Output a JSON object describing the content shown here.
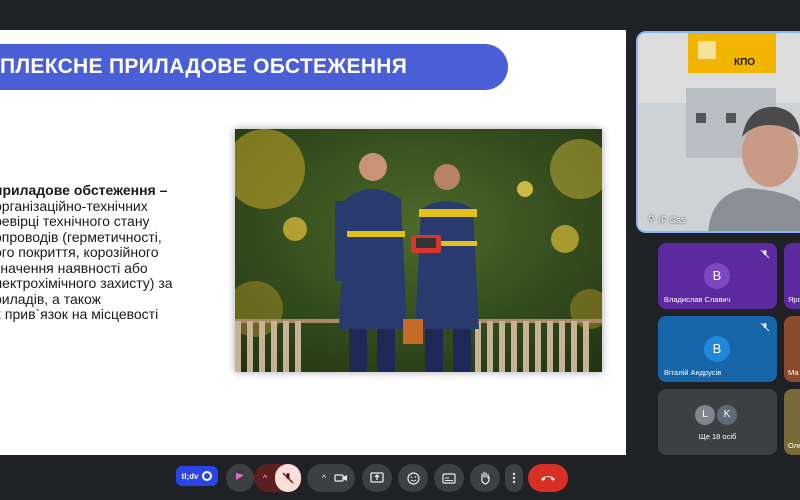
{
  "slide": {
    "title": "ПЛЕКСНЕ ПРИЛАДОВЕ ОБСТЕЖЕННЯ",
    "text_lines": [
      {
        "text": "приладове обстеження –",
        "bold": true
      },
      {
        "text": "організаційно-технічних",
        "bold": false
      },
      {
        "text": "ревірці технічного стану",
        "bold": false
      },
      {
        "text": "опроводів (герметичності,",
        "bold": false
      },
      {
        "text": "ого покриття, корозійного",
        "bold": false
      },
      {
        "text": "значення наявності або",
        "bold": false
      },
      {
        "text": "лектрохімічного захисту) за",
        "bold": false
      },
      {
        "text": "риладів, а також",
        "bold": false
      },
      {
        "text": "х прив`язок на місцевості",
        "bold": false
      }
    ]
  },
  "speaker": {
    "name": "IF Gas",
    "sign_text": "КПО"
  },
  "participants": [
    {
      "initial": "В",
      "name": "Владислав Славич",
      "color": "#5b2a9e",
      "muted": true
    },
    {
      "initial": "",
      "name": "Яро",
      "color": "#5b2a9e",
      "muted": false
    },
    {
      "initial": "В",
      "name": "Віталій Андрусів",
      "color": "#1565a8",
      "muted": true
    },
    {
      "initial": "",
      "name": "Ма",
      "color": "#8a4b2a",
      "muted": false
    },
    {
      "initials": [
        "L",
        "K"
      ],
      "name": "Ще 18 осіб",
      "color": "#3c4043"
    },
    {
      "initial": "",
      "name": "Оле",
      "color": "#7a6a3a",
      "muted": false
    }
  ],
  "controls": {
    "brand_label": "tl;dv",
    "colors": {
      "brand": "#2b44e8",
      "mic_off_bg": "#f9dedc",
      "mic_group": "#5c1f1f",
      "end_call": "#d93025"
    }
  }
}
